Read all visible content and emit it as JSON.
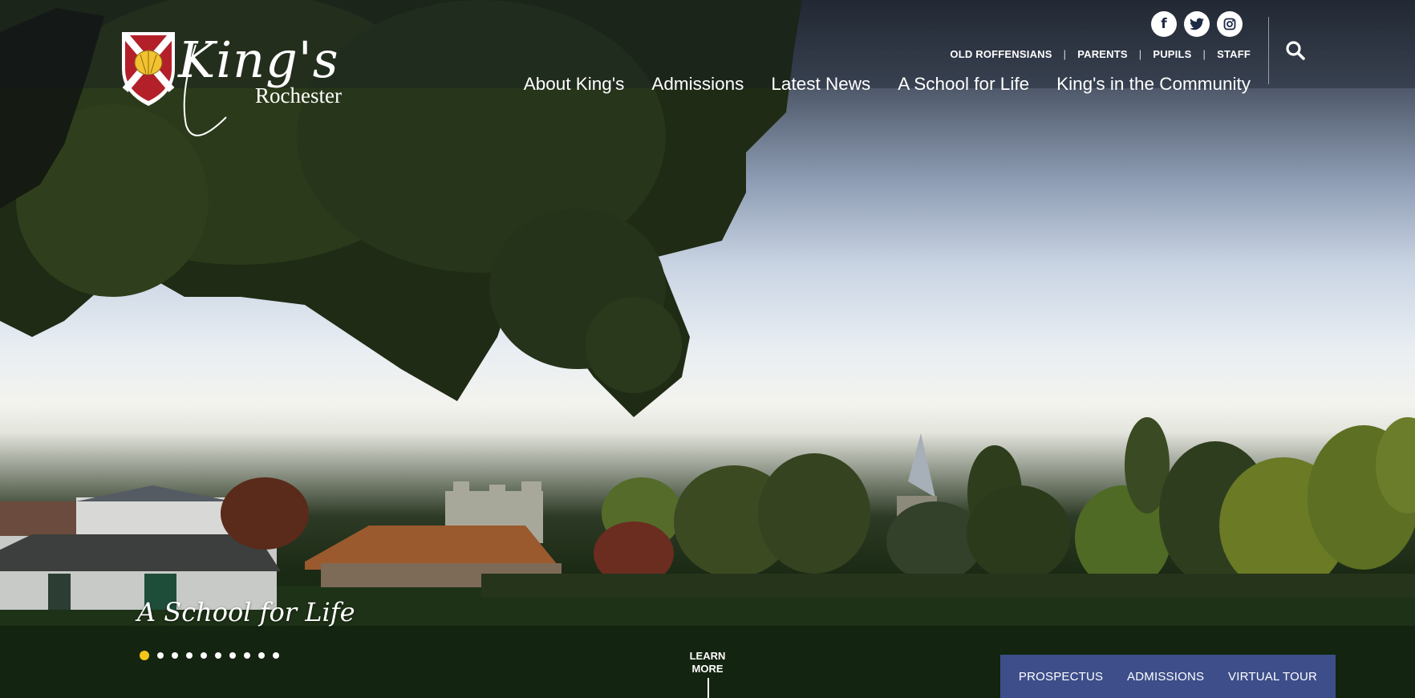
{
  "brand": {
    "logo_main": "King's",
    "logo_sub": "Rochester"
  },
  "social": [
    {
      "icon": "facebook-icon",
      "glyph": "f"
    },
    {
      "icon": "twitter-icon",
      "glyph": "t"
    },
    {
      "icon": "instagram-icon",
      "glyph": "◎"
    }
  ],
  "utility_nav": [
    "OLD ROFFENSIANS",
    "PARENTS",
    "PUPILS",
    "STAFF"
  ],
  "main_nav": [
    "About King's",
    "Admissions",
    "Latest News",
    "A School for Life",
    "King's in the Community"
  ],
  "hero": {
    "tagline": "A School for Life",
    "slides_total": 10,
    "active_slide": 1
  },
  "learn_more": "LEARN MORE",
  "cta": [
    "PROSPECTUS",
    "ADMISSIONS",
    "VIRTUAL TOUR"
  ],
  "colors": {
    "cta_bar": "#3d4e8a",
    "active_dot": "#f5c518",
    "shield_red": "#b3202a",
    "shell_gold": "#f2c230"
  }
}
